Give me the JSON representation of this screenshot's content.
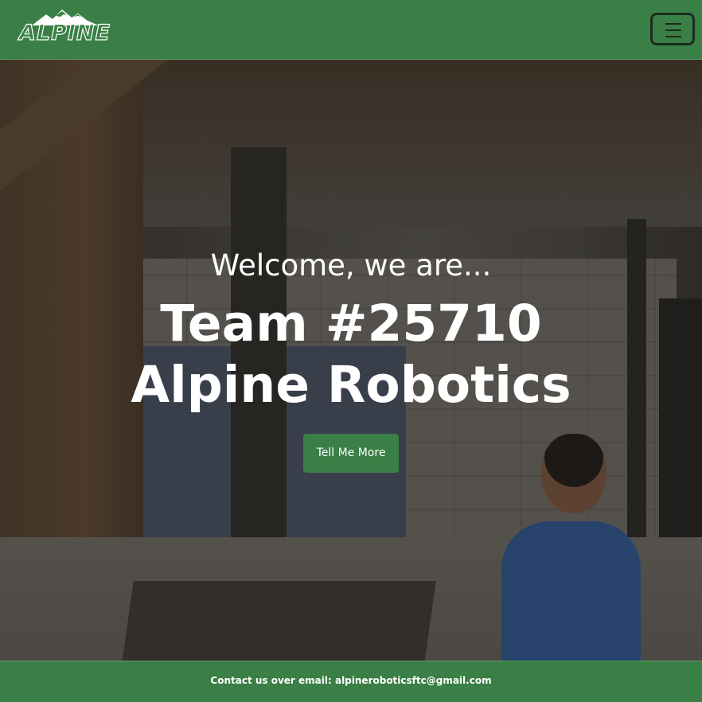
{
  "navbar": {
    "logo_text": "ALPINE",
    "menu_icon": "hamburger-menu-icon"
  },
  "hero": {
    "welcome": "Welcome, we are...",
    "title_line1": "Team #25710",
    "title_line2": "Alpine Robotics",
    "cta_label": "Tell Me More",
    "background": "photo of team member at workstation in basement workshop"
  },
  "footer": {
    "contact": "Contact us over email: alpineroboticsftc@gmail.com"
  },
  "colors": {
    "brand_green": "#3a7f45",
    "text_on_brand": "#ffffff"
  }
}
